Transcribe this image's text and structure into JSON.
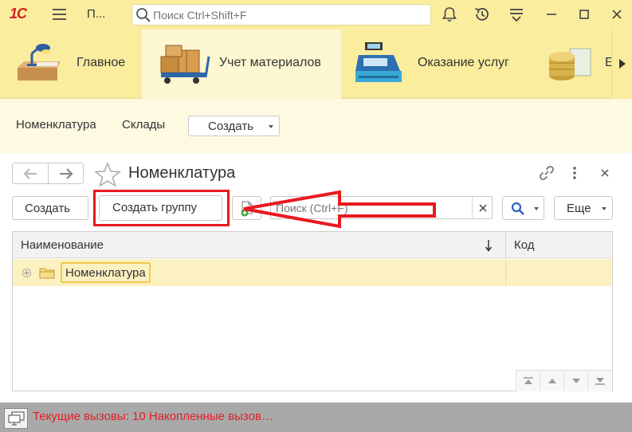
{
  "titlebar": {
    "logo": "1С",
    "app_title": "П...",
    "search_placeholder": "Поиск Ctrl+Shift+F"
  },
  "sections": [
    {
      "label": "Главное",
      "icon": "desk-lamp-icon"
    },
    {
      "label": "Учет материалов",
      "icon": "warehouse-boxes-icon",
      "active": true
    },
    {
      "label": "Оказание услуг",
      "icon": "cash-register-icon"
    },
    {
      "label": "Е",
      "icon": "coins-icon"
    }
  ],
  "function_panel": {
    "links": [
      "Номенклатура",
      "Склады"
    ],
    "create_label": "Создать"
  },
  "form": {
    "title": "Номенклатура",
    "create_label": "Создать",
    "create_group_label": "Создать группу",
    "search_placeholder": "Поиск (Ctrl+F)",
    "more_label": "Еще"
  },
  "table": {
    "columns": [
      "Наименование",
      "Код"
    ],
    "rows": [
      {
        "name": "Номенклатура",
        "code": ""
      }
    ]
  },
  "statusbar": {
    "text": "Текущие вызовы: 10   Накопленные вызов…"
  },
  "colors": {
    "accent_yellow": "#fbed9e",
    "highlight_row": "#fbf1c1",
    "annotation_red": "#e8191f",
    "status_red": "#e41e26"
  }
}
